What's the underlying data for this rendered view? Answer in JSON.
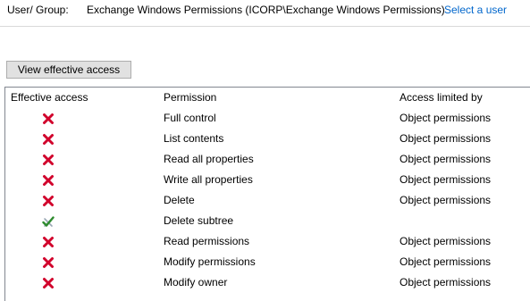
{
  "user_group": {
    "label": "User/ Group:",
    "value": "Exchange Windows Permissions (ICORP\\Exchange Windows Permissions)",
    "select_link": "Select a user"
  },
  "view_button_label": "View effective access",
  "table": {
    "headers": [
      "Effective access",
      "Permission",
      "Access limited by"
    ],
    "rows": [
      {
        "icon": "denied-x-icon",
        "permission": "Full control",
        "limited_by": "Object permissions"
      },
      {
        "icon": "denied-x-icon",
        "permission": "List contents",
        "limited_by": "Object permissions"
      },
      {
        "icon": "denied-x-icon",
        "permission": "Read all properties",
        "limited_by": "Object permissions"
      },
      {
        "icon": "denied-x-icon",
        "permission": "Write all properties",
        "limited_by": "Object permissions"
      },
      {
        "icon": "denied-x-icon",
        "permission": "Delete",
        "limited_by": "Object permissions"
      },
      {
        "icon": "allowed-check-icon",
        "permission": "Delete subtree",
        "limited_by": ""
      },
      {
        "icon": "denied-x-icon",
        "permission": "Read permissions",
        "limited_by": "Object permissions"
      },
      {
        "icon": "denied-x-icon",
        "permission": "Modify permissions",
        "limited_by": "Object permissions"
      },
      {
        "icon": "denied-x-icon",
        "permission": "Modify owner",
        "limited_by": "Object permissions"
      }
    ]
  },
  "colors": {
    "link": "#0066cc",
    "denied": "#d1002b",
    "allowed": "#2e8b2e"
  }
}
